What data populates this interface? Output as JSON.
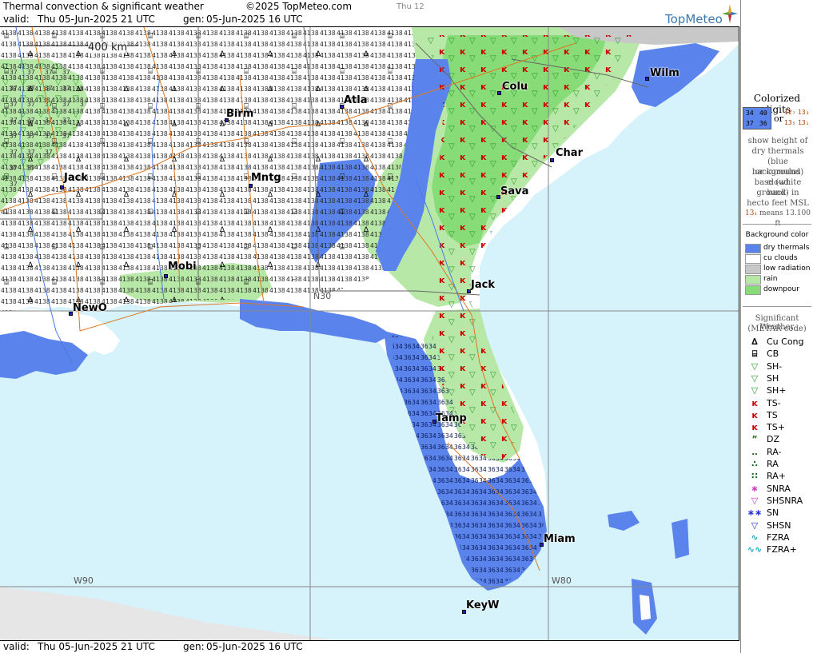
{
  "header": {
    "title": "Thermal convection & significant weather",
    "copyright": "©2025 TopMeteo.com",
    "day_tab": "Thu 12",
    "valid_label": "valid:",
    "valid_value": "Thu  05-Jun-2025  21 UTC",
    "gen_label": "gen:",
    "gen_value": "05-Jun-2025 16 UTC",
    "brand": "TopMeteo"
  },
  "footer": {
    "valid_label": "valid:",
    "valid_value": "Thu  05-Jun-2025  21 UTC",
    "gen_label": "gen:",
    "gen_value": "05-Jun-2025 16 UTC"
  },
  "map": {
    "scale_label": "400 km",
    "grid_labels": [
      "W90",
      "W80",
      "N30"
    ],
    "cities": [
      "Wilm",
      "Colu",
      "Atla",
      "Birm",
      "Char",
      "Jack",
      "Mntg",
      "Sava",
      "Mobi",
      "Jack",
      "NewO",
      "Tamp",
      "Miam",
      "KeyW"
    ],
    "colors": {
      "sea": "#d6f2fb",
      "cu_clouds": "#ffffff",
      "dry_thermals": "#5a84ec",
      "low_radiation": "#c8c8c8",
      "rain": "#b8e8a8",
      "downpour": "#88dc78",
      "ts_symbol": "#cc0000",
      "sh_symbol": "#2a9a2a",
      "roads": "#dd7722",
      "borders": "#666666",
      "rivers": "#4a7ae0"
    }
  },
  "legend": {
    "colorized_title": "Colorized digits",
    "sample_blue": [
      "34",
      "40",
      "37",
      "36"
    ],
    "sample_or": "or",
    "sample_white": [
      "12₇",
      "13₃",
      "13₅",
      "13₁"
    ],
    "explain_lines": [
      "show height of",
      "dry thermals",
      "(blue background)",
      "or cumulus cloud",
      "base (white back-",
      "ground) in",
      "hecto feet MSL"
    ],
    "example_value": "13₁",
    "example_text": "means 13.100 ft",
    "bg_title": "Background color",
    "bg_items": [
      {
        "label": "dry thermals",
        "color": "#5a84ec"
      },
      {
        "label": "cu clouds",
        "color": "#ffffff"
      },
      {
        "label": "low radiation",
        "color": "#c8c8c8"
      },
      {
        "label": "rain",
        "color": "#b8e8a8"
      },
      {
        "label": "downpour",
        "color": "#88dc78"
      }
    ],
    "wx_title": "Significant Weather",
    "wx_subtitle": "(METAR code)",
    "wx_items": [
      {
        "label": "Cu Cong",
        "symbol": "∆",
        "color": "#000000"
      },
      {
        "label": "CB",
        "symbol": "⌸",
        "color": "#000000"
      },
      {
        "label": "SH-",
        "symbol": "▽",
        "color": "#2a9a2a"
      },
      {
        "label": "SH",
        "symbol": "▽",
        "color": "#2a9a2a"
      },
      {
        "label": "SH+",
        "symbol": "▽",
        "color": "#2a9a2a"
      },
      {
        "label": "TS-",
        "symbol": "ĸ",
        "color": "#cc0000"
      },
      {
        "label": "TS",
        "symbol": "ĸ",
        "color": "#cc0000"
      },
      {
        "label": "TS+",
        "symbol": "ĸ",
        "color": "#cc0000"
      },
      {
        "label": "DZ",
        "symbol": "”",
        "color": "#1a6a1a"
      },
      {
        "label": "RA-",
        "symbol": "‥",
        "color": "#1a6a1a"
      },
      {
        "label": "RA",
        "symbol": "∴",
        "color": "#1a6a1a"
      },
      {
        "label": "RA+",
        "symbol": "∷",
        "color": "#1a6a1a"
      },
      {
        "label": "SNRA",
        "symbol": "∗",
        "color": "#cc33cc"
      },
      {
        "label": "SHSNRA",
        "symbol": "▽",
        "color": "#cc33cc"
      },
      {
        "label": "SN",
        "symbol": "∗∗",
        "color": "#2233cc"
      },
      {
        "label": "SHSN",
        "symbol": "▽",
        "color": "#2233cc"
      },
      {
        "label": "FZRA",
        "symbol": "∿",
        "color": "#22aacc"
      },
      {
        "label": "FZRA+",
        "symbol": "∿∿",
        "color": "#22aacc"
      }
    ]
  }
}
